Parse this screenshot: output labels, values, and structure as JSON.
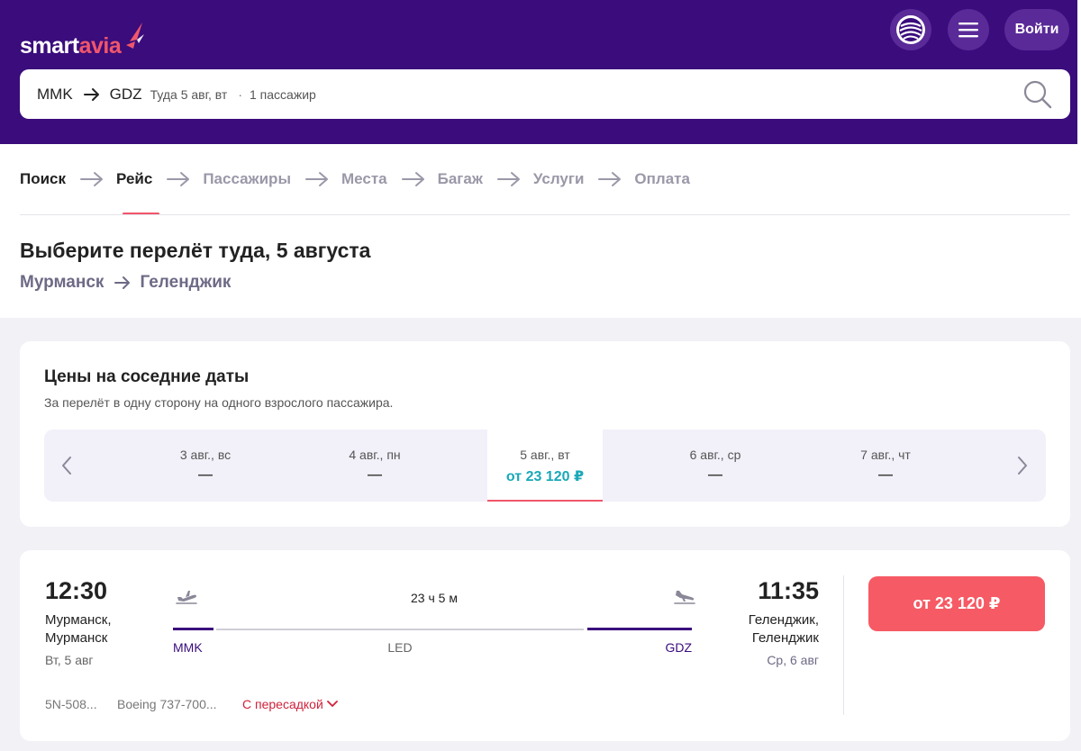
{
  "brand": {
    "name_part1": "smart",
    "name_part2": "avia",
    "accent": "#f0566b",
    "header_bg": "#3a0c7c"
  },
  "header": {
    "globe_icon": "globe-icon",
    "menu_icon": "hamburger-icon",
    "login_label": "Войти"
  },
  "search": {
    "from": "MMK",
    "to": "GDZ",
    "date": "Туда 5 авг, вт",
    "passengers": "1 пассажир"
  },
  "steps": [
    {
      "label": "Поиск",
      "state": "done"
    },
    {
      "label": "Рейс",
      "state": "active"
    },
    {
      "label": "Пассажиры",
      "state": "pending"
    },
    {
      "label": "Места",
      "state": "pending"
    },
    {
      "label": "Багаж",
      "state": "pending"
    },
    {
      "label": "Услуги",
      "state": "pending"
    },
    {
      "label": "Оплата",
      "state": "pending"
    }
  ],
  "page": {
    "title": "Выберите перелёт туда, 5 августа",
    "route_from": "Мурманск",
    "route_to": "Геленджик"
  },
  "nearby": {
    "title": "Цены на соседние даты",
    "subtitle": "За перелёт в одну сторону на одного взрослого пассажира.",
    "days": [
      {
        "label": "3 авг., вс",
        "price": "—"
      },
      {
        "label": "4 авг., пн",
        "price": "—"
      },
      {
        "label": "5 авг., вт",
        "price": "от 23 120 ₽",
        "selected": true
      },
      {
        "label": "6 авг., ср",
        "price": "—"
      },
      {
        "label": "7 авг., чт",
        "price": "—"
      }
    ]
  },
  "flight": {
    "dep_time": "12:30",
    "dep_city_line1": "Мурманск,",
    "dep_city_line2": "Мурманск",
    "dep_date": "Вт, 5 авг",
    "arr_time": "11:35",
    "arr_city_line1": "Геленджик,",
    "arr_city_line2": "Геленджик",
    "arr_date": "Ср, 6 авг",
    "duration": "23 ч 5 м",
    "dep_code": "MMK",
    "transfer_code": "LED",
    "arr_code": "GDZ",
    "flight_number": "5N-508...",
    "aircraft": "Boeing 737-700...",
    "stops_label": "С пересадкой",
    "price_label": "от 23 120 ₽"
  }
}
